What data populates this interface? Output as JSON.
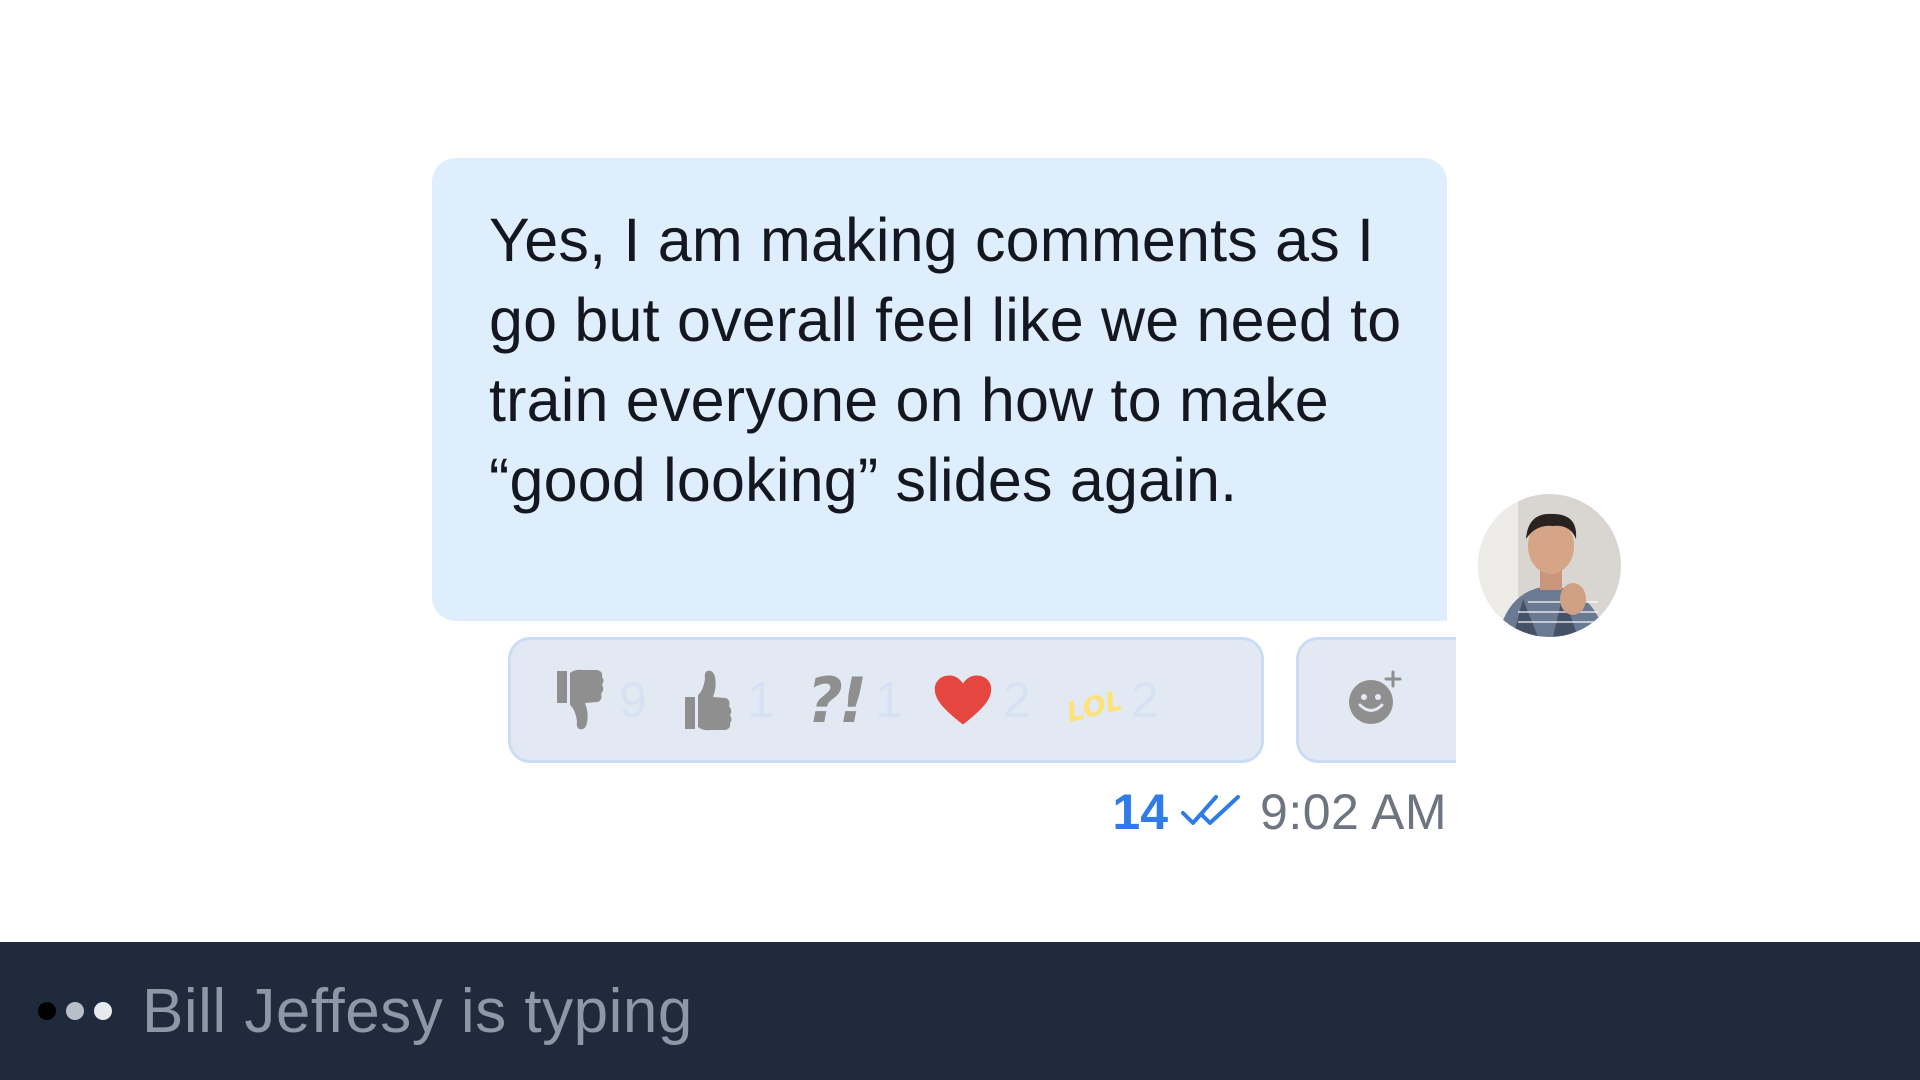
{
  "message": {
    "text": "Yes, I am making comments as I go but overall feel like we need to train everyone on how to make “good looking” slides again.",
    "read_count": "14",
    "time": "9:02 AM"
  },
  "reactions": [
    {
      "name": "thumbs-down",
      "count": "9",
      "icon": "thumbs-down-icon"
    },
    {
      "name": "thumbs-up",
      "count": "1",
      "icon": "thumbs-up-icon"
    },
    {
      "name": "interrobang",
      "label": "?!",
      "count": "1",
      "icon": "interrobang-icon"
    },
    {
      "name": "heart",
      "count": "2",
      "icon": "heart-icon"
    },
    {
      "name": "lol",
      "label": "LOL",
      "count": "2",
      "icon": "lol-icon"
    }
  ],
  "typing": {
    "text": "Bill Jeffesy is typing"
  },
  "colors": {
    "bubble": "#dfeefc",
    "accent": "#2f7ce9",
    "bar": "#1f2a3c",
    "heart": "#e5463f",
    "lol": "#fde27a"
  }
}
